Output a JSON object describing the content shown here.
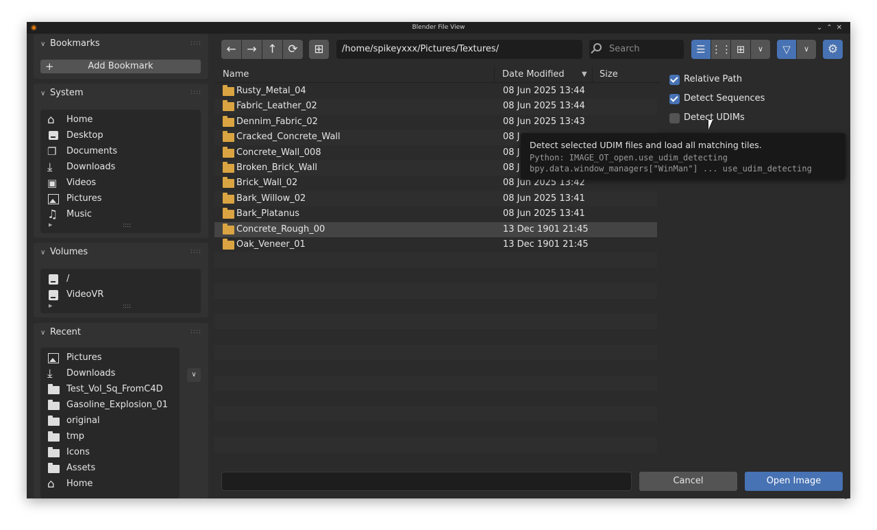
{
  "window": {
    "title": "Blender File View"
  },
  "sidebar": {
    "bookmarks": {
      "title": "Bookmarks",
      "add_label": "Add Bookmark"
    },
    "system": {
      "title": "System",
      "items": [
        {
          "label": "Home",
          "icon": "home-icon"
        },
        {
          "label": "Desktop",
          "icon": "desktop-icon"
        },
        {
          "label": "Documents",
          "icon": "documents-icon"
        },
        {
          "label": "Downloads",
          "icon": "download-icon"
        },
        {
          "label": "Videos",
          "icon": "video-icon"
        },
        {
          "label": "Pictures",
          "icon": "image-icon"
        },
        {
          "label": "Music",
          "icon": "music-icon"
        }
      ]
    },
    "volumes": {
      "title": "Volumes",
      "items": [
        {
          "label": "/",
          "icon": "drive-icon"
        },
        {
          "label": "VideoVR",
          "icon": "drive-icon"
        }
      ]
    },
    "recent": {
      "title": "Recent",
      "items": [
        {
          "label": "Pictures",
          "icon": "image-icon"
        },
        {
          "label": "Downloads",
          "icon": "download-icon"
        },
        {
          "label": "Test_Vol_Sq_FromC4D",
          "icon": "folder-icon"
        },
        {
          "label": "Gasoline_Explosion_01",
          "icon": "folder-icon"
        },
        {
          "label": "original",
          "icon": "folder-icon"
        },
        {
          "label": "tmp",
          "icon": "folder-icon"
        },
        {
          "label": "Icons",
          "icon": "folder-icon"
        },
        {
          "label": "Assets",
          "icon": "folder-icon"
        },
        {
          "label": "Home",
          "icon": "home-icon"
        }
      ]
    }
  },
  "toolbar": {
    "path": "/home/spikeyxxx/Pictures/Textures/",
    "search_placeholder": "Search"
  },
  "columns": {
    "name": "Name",
    "date": "Date Modified",
    "size": "Size"
  },
  "files": [
    {
      "name": "Rusty_Metal_04",
      "date": "08 Jun 2025 13:44"
    },
    {
      "name": "Fabric_Leather_02",
      "date": "08 Jun 2025 13:44"
    },
    {
      "name": "Dennim_Fabric_02",
      "date": "08 Jun 2025 13:43"
    },
    {
      "name": "Cracked_Concrete_Wall",
      "date": "08 J"
    },
    {
      "name": "Concrete_Wall_008",
      "date": "08 J"
    },
    {
      "name": "Broken_Brick_Wall",
      "date": "08 J"
    },
    {
      "name": "Brick_Wall_02",
      "date": "08 Jun 2025 13:42"
    },
    {
      "name": "Bark_Willow_02",
      "date": "08 Jun 2025 13:41"
    },
    {
      "name": "Bark_Platanus",
      "date": "08 Jun 2025 13:41"
    },
    {
      "name": "Concrete_Rough_00",
      "date": "13 Dec 1901 21:45",
      "selected": true
    },
    {
      "name": "Oak_Veneer_01",
      "date": "13 Dec 1901 21:45"
    }
  ],
  "options": {
    "relative_path": {
      "label": "Relative Path",
      "checked": true
    },
    "detect_sequences": {
      "label": "Detect Sequences",
      "checked": true
    },
    "detect_udims": {
      "label": "Detect UDIMs",
      "checked": false
    }
  },
  "tooltip": {
    "description": "Detect selected UDIM files and load all matching tiles.",
    "python": "Python: IMAGE_OT_open.use_udim_detecting",
    "path": "bpy.data.window_managers[\"WinMan\"] ... use_udim_detecting"
  },
  "footer": {
    "cancel_label": "Cancel",
    "open_label": "Open Image"
  },
  "colors": {
    "accent": "#4772b3",
    "background": "#2b2b2b",
    "folder": "#d9a441"
  }
}
